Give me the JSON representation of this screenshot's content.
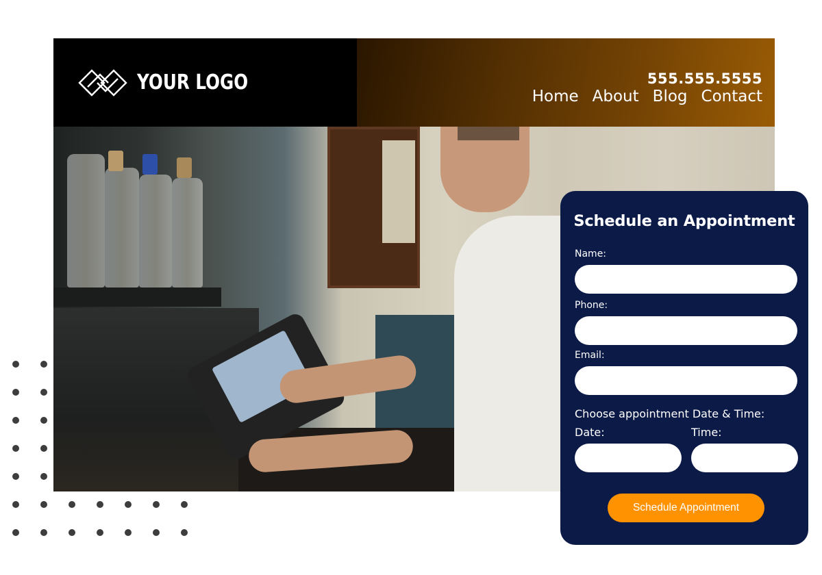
{
  "brand": {
    "logo_text": "YOUR LOGO",
    "logo_icon": "interlocking-diamonds-logo-icon"
  },
  "header": {
    "phone": "555.555.5555",
    "nav": [
      {
        "label": "Home"
      },
      {
        "label": "About"
      },
      {
        "label": "Blog"
      },
      {
        "label": "Contact"
      }
    ],
    "gradient_colors": [
      "#2a1600",
      "#9a5c05"
    ]
  },
  "hero": {
    "image_description": "Bartender using a tablet point-of-sale terminal behind a bar with bottles"
  },
  "form": {
    "title": "Schedule an Appointment",
    "fields": {
      "name": {
        "label": "Name:",
        "value": "",
        "placeholder": ""
      },
      "phone": {
        "label": "Phone:",
        "value": "",
        "placeholder": ""
      },
      "email": {
        "label": "Email:",
        "value": "",
        "placeholder": ""
      },
      "datetime_heading": "Choose appointment Date & Time:",
      "date": {
        "label": "Date:",
        "value": "",
        "placeholder": ""
      },
      "time": {
        "label": "Time:",
        "value": "",
        "placeholder": ""
      }
    },
    "submit_label": "Schedule Appointment",
    "colors": {
      "card": "#0c1a48",
      "button": "#ff9200"
    }
  },
  "decoration": {
    "dot_pattern": "dot-grid"
  }
}
